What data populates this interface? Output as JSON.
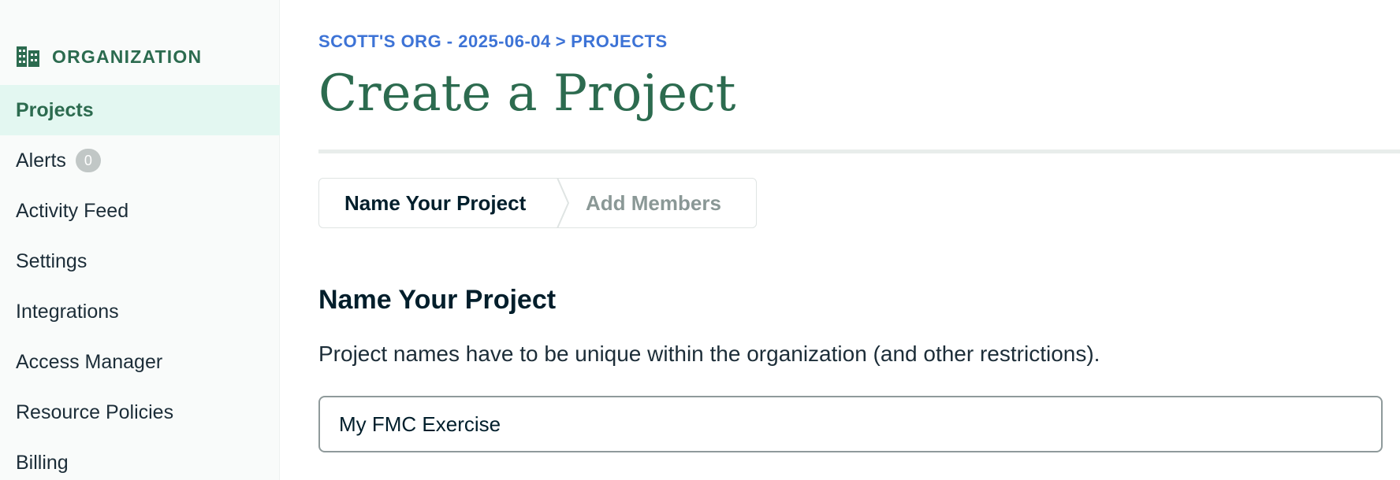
{
  "sidebar": {
    "org_label": "ORGANIZATION",
    "org_icon": "building-icon",
    "items": [
      {
        "label": "Projects",
        "active": true
      },
      {
        "label": "Alerts",
        "badge": "0"
      },
      {
        "label": "Activity Feed"
      },
      {
        "label": "Settings"
      },
      {
        "label": "Integrations"
      },
      {
        "label": "Access Manager"
      },
      {
        "label": "Resource Policies"
      },
      {
        "label": "Billing"
      }
    ]
  },
  "breadcrumb": {
    "org": "SCOTT'S ORG - 2025-06-04",
    "separator": ">",
    "page": "PROJECTS"
  },
  "page_title": "Create a Project",
  "stepper": {
    "steps": [
      {
        "label": "Name Your Project",
        "state": "current"
      },
      {
        "label": "Add Members",
        "state": "upcoming"
      }
    ]
  },
  "section": {
    "heading": "Name Your Project",
    "description": "Project names have to be unique within the organization (and other restrictions)."
  },
  "project_name_input": {
    "value": "My FMC Exercise"
  },
  "colors": {
    "brand_green": "#2c6b4f",
    "link_blue": "#3d73d6",
    "active_bg": "#e3f7f1"
  }
}
